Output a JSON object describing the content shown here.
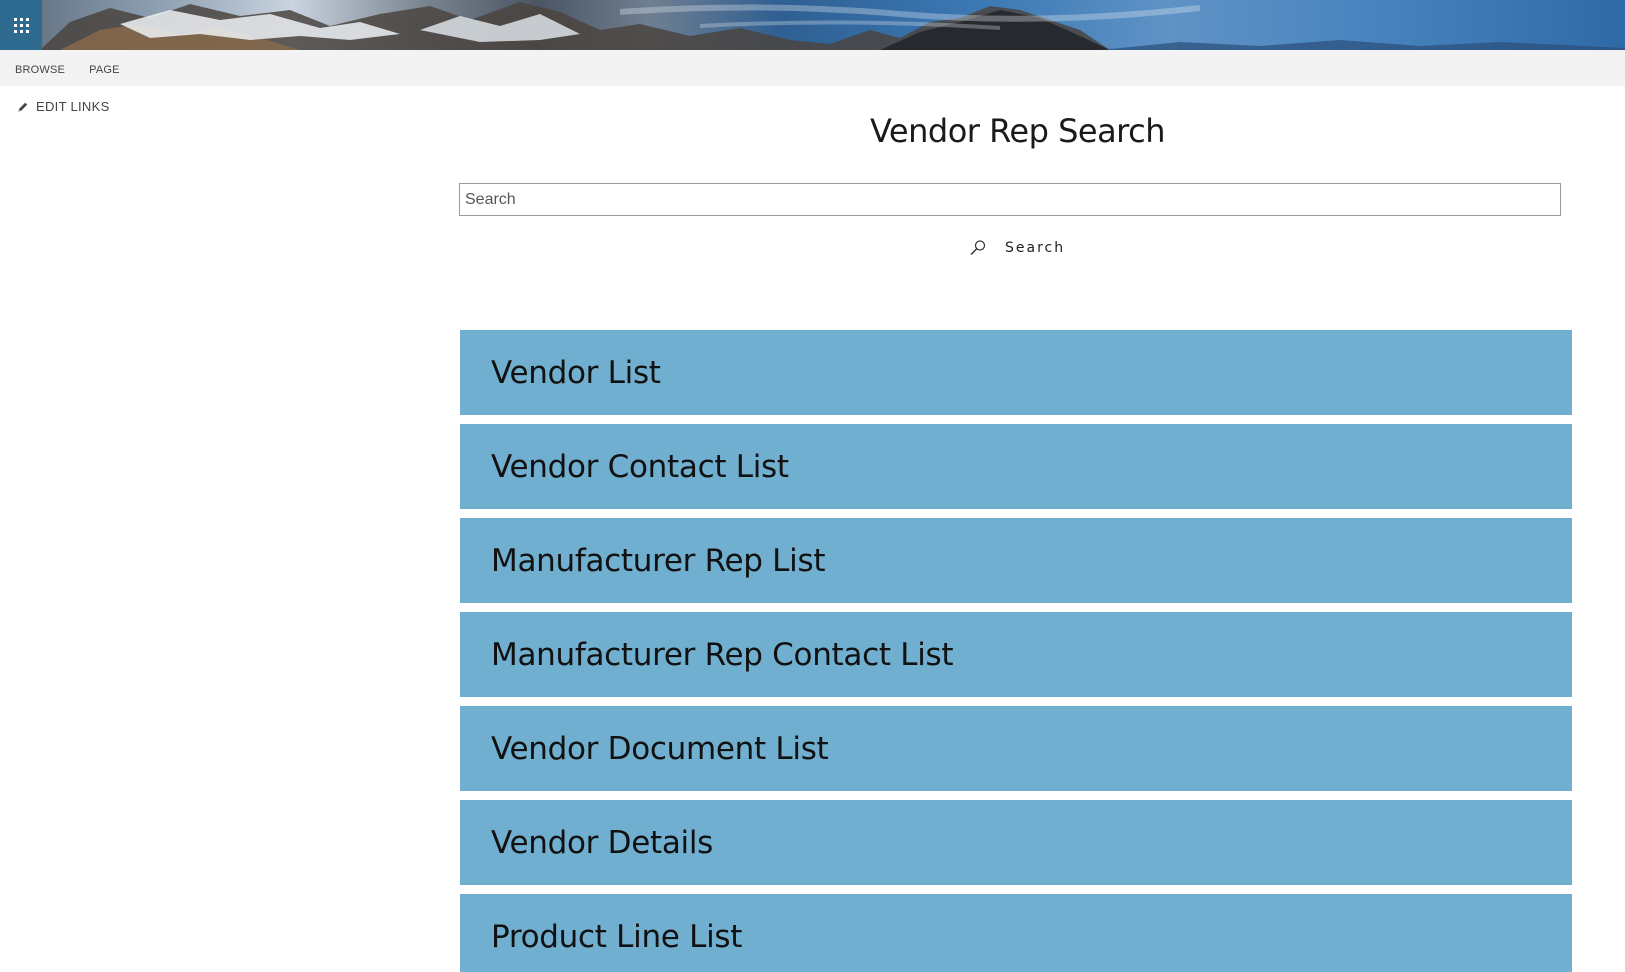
{
  "suite_bar": {
    "app_launcher_icon": "waffle-grid-icon"
  },
  "ribbon": {
    "tabs": [
      "BROWSE",
      "PAGE"
    ]
  },
  "left_nav": {
    "edit_links_label": "EDIT LINKS",
    "edit_links_icon": "pencil-icon"
  },
  "main": {
    "title": "Vendor Rep Search",
    "search": {
      "placeholder": "Search",
      "value": "",
      "button_label": "Search",
      "button_icon": "magnifier-icon"
    },
    "tiles": [
      {
        "label": "Vendor List"
      },
      {
        "label": "Vendor Contact List"
      },
      {
        "label": "Manufacturer Rep List"
      },
      {
        "label": "Manufacturer Rep Contact List"
      },
      {
        "label": "Vendor Document List"
      },
      {
        "label": "Vendor Details"
      },
      {
        "label": "Product Line List"
      }
    ]
  },
  "colors": {
    "tile_background": "#70afd0",
    "ribbon_background": "#f3f3f3",
    "app_launcher_background": "#2f6b90"
  }
}
